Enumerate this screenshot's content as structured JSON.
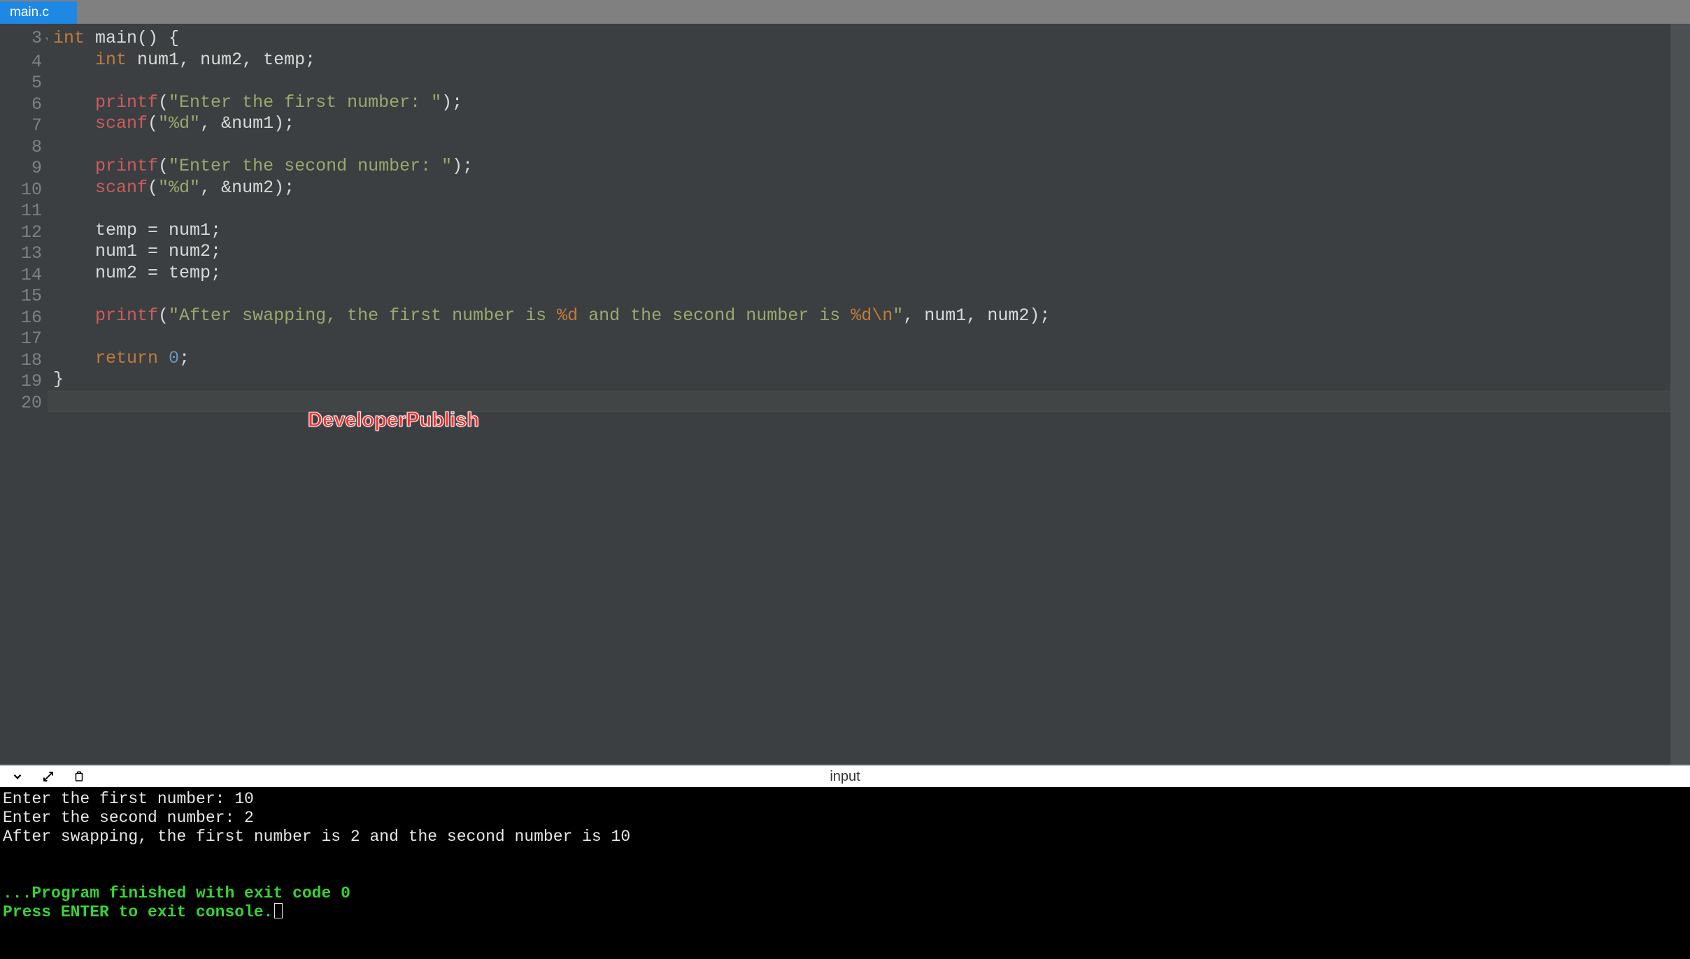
{
  "tabs": {
    "active": "main.c"
  },
  "gutter": {
    "start": 3,
    "end": 20,
    "fold_at": 3
  },
  "code": {
    "lines": [
      {
        "n": 3,
        "tokens": [
          [
            "type",
            "int"
          ],
          [
            "punct",
            " "
          ],
          [
            "ident",
            "main"
          ],
          [
            "punct",
            "() {"
          ]
        ]
      },
      {
        "n": 4,
        "tokens": [
          [
            "punct",
            "    "
          ],
          [
            "type",
            "int"
          ],
          [
            "punct",
            " "
          ],
          [
            "ident",
            "num1"
          ],
          [
            "punct",
            ", "
          ],
          [
            "ident",
            "num2"
          ],
          [
            "punct",
            ", "
          ],
          [
            "ident",
            "temp"
          ],
          [
            "punct",
            ";"
          ]
        ]
      },
      {
        "n": 5,
        "tokens": []
      },
      {
        "n": 6,
        "tokens": [
          [
            "punct",
            "    "
          ],
          [
            "func",
            "printf"
          ],
          [
            "punct",
            "("
          ],
          [
            "str",
            "\"Enter the first number: \""
          ],
          [
            "punct",
            ");"
          ]
        ]
      },
      {
        "n": 7,
        "tokens": [
          [
            "punct",
            "    "
          ],
          [
            "func",
            "scanf"
          ],
          [
            "punct",
            "("
          ],
          [
            "str",
            "\"%d\""
          ],
          [
            "punct",
            ", &"
          ],
          [
            "ident",
            "num1"
          ],
          [
            "punct",
            ");"
          ]
        ]
      },
      {
        "n": 8,
        "tokens": []
      },
      {
        "n": 9,
        "tokens": [
          [
            "punct",
            "    "
          ],
          [
            "func",
            "printf"
          ],
          [
            "punct",
            "("
          ],
          [
            "str",
            "\"Enter the second number: \""
          ],
          [
            "punct",
            ");"
          ]
        ]
      },
      {
        "n": 10,
        "tokens": [
          [
            "punct",
            "    "
          ],
          [
            "func",
            "scanf"
          ],
          [
            "punct",
            "("
          ],
          [
            "str",
            "\"%d\""
          ],
          [
            "punct",
            ", &"
          ],
          [
            "ident",
            "num2"
          ],
          [
            "punct",
            ");"
          ]
        ]
      },
      {
        "n": 11,
        "tokens": []
      },
      {
        "n": 12,
        "tokens": [
          [
            "punct",
            "    "
          ],
          [
            "ident",
            "temp"
          ],
          [
            "punct",
            " = "
          ],
          [
            "ident",
            "num1"
          ],
          [
            "punct",
            ";"
          ]
        ]
      },
      {
        "n": 13,
        "tokens": [
          [
            "punct",
            "    "
          ],
          [
            "ident",
            "num1"
          ],
          [
            "punct",
            " = "
          ],
          [
            "ident",
            "num2"
          ],
          [
            "punct",
            ";"
          ]
        ]
      },
      {
        "n": 14,
        "tokens": [
          [
            "punct",
            "    "
          ],
          [
            "ident",
            "num2"
          ],
          [
            "punct",
            " = "
          ],
          [
            "ident",
            "temp"
          ],
          [
            "punct",
            ";"
          ]
        ]
      },
      {
        "n": 15,
        "tokens": []
      },
      {
        "n": 16,
        "tokens": [
          [
            "punct",
            "    "
          ],
          [
            "func",
            "printf"
          ],
          [
            "punct",
            "("
          ],
          [
            "str",
            "\"After swapping, the first number is "
          ],
          [
            "fmt",
            "%d"
          ],
          [
            "str",
            " and the second number is "
          ],
          [
            "fmt",
            "%d"
          ],
          [
            "esc",
            "\\n"
          ],
          [
            "str",
            "\""
          ],
          [
            "punct",
            ", "
          ],
          [
            "ident",
            "num1"
          ],
          [
            "punct",
            ", "
          ],
          [
            "ident",
            "num2"
          ],
          [
            "punct",
            ");"
          ]
        ]
      },
      {
        "n": 17,
        "tokens": []
      },
      {
        "n": 18,
        "tokens": [
          [
            "punct",
            "    "
          ],
          [
            "kw",
            "return"
          ],
          [
            "punct",
            " "
          ],
          [
            "num",
            "0"
          ],
          [
            "punct",
            ";"
          ]
        ]
      },
      {
        "n": 19,
        "tokens": [
          [
            "punct",
            "}"
          ]
        ]
      },
      {
        "n": 20,
        "tokens": []
      }
    ],
    "active_line": 20
  },
  "console_toolbar": {
    "label": "input"
  },
  "console": {
    "stdout": [
      "Enter the first number: 10",
      "Enter the second number: 2",
      "After swapping, the first number is 2 and the second number is 10",
      "",
      ""
    ],
    "status": [
      "...Program finished with exit code 0",
      "Press ENTER to exit console."
    ]
  },
  "watermark": "DeveloperPublish",
  "colors": {
    "tab_active_bg": "#1e88e5",
    "editor_bg": "#3b3f41",
    "tabbar_bg": "#808080",
    "func": "#cd5c5c",
    "string": "#9aa96d",
    "keyword_type": "#c07c3a",
    "number": "#6897bb",
    "console_green": "#35d435"
  }
}
